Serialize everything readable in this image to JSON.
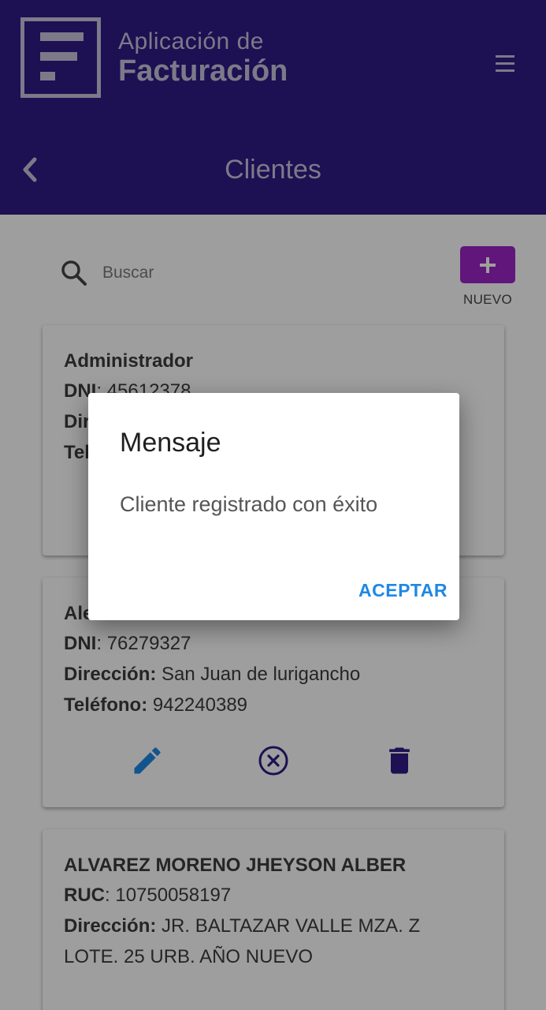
{
  "app": {
    "title_line1": "Aplicación de",
    "title_line2": "Facturación",
    "logo_icon": "document-lines-logo",
    "menu_icon": "hamburger-menu-icon"
  },
  "toolbar": {
    "back_icon": "chevron-left-icon",
    "page_title": "Clientes"
  },
  "search": {
    "placeholder": "Buscar",
    "value": ""
  },
  "new_button": {
    "icon": "plus-icon",
    "label": "NUEVO"
  },
  "clients": [
    {
      "name": "Administrador",
      "doc_label": "DNI",
      "doc_value": "45612378",
      "address_label": "Dirección:",
      "address_value": "",
      "phone_label": "Teléfono:",
      "phone_value": ""
    },
    {
      "name": "Alex Mendoza Huaman",
      "doc_label": "DNI",
      "doc_value": "76279327",
      "address_label": "Dirección:",
      "address_value": "San Juan de lurigancho",
      "phone_label": "Teléfono:",
      "phone_value": "942240389"
    },
    {
      "name": "ALVAREZ MORENO JHEYSON ALBER",
      "doc_label": "RUC",
      "doc_value": "10750058197",
      "address_label": "Dirección:",
      "address_value_line1": "JR. BALTAZAR VALLE MZA. Z",
      "address_value_line2": "LOTE. 25 URB. AÑO NUEVO"
    }
  ],
  "card_actions": {
    "edit_icon": "pencil-icon",
    "deactivate_icon": "circle-x-icon",
    "delete_icon": "trash-icon"
  },
  "dialog": {
    "title": "Mensaje",
    "message": "Cliente registrado con éxito",
    "accept_label": "ACEPTAR"
  },
  "colors": {
    "header_bg": "#2f1b86",
    "new_button_bg": "#9b25c6",
    "action_icon_blue": "#1e88e5",
    "action_icon_purple": "#2f1b86",
    "dialog_button": "#1e88e5"
  }
}
